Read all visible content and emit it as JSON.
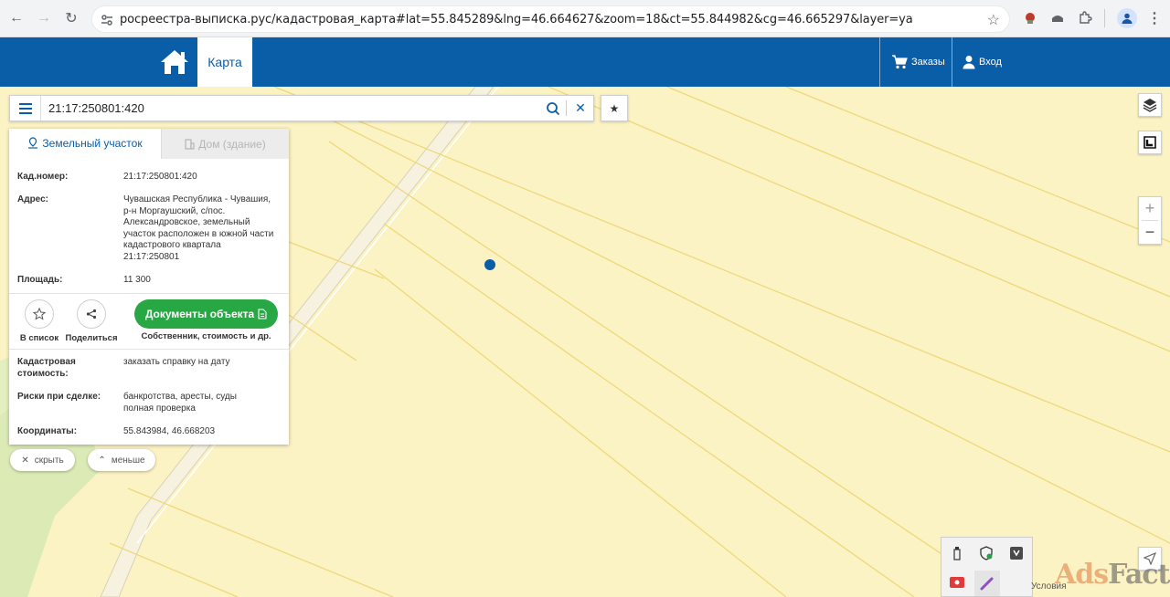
{
  "browser": {
    "url": "росреестра-выписка.рус/кадастровая_карта#lat=55.845289&lng=46.664627&zoom=18&ct=55.844982&cg=46.665297&layer=ya"
  },
  "header": {
    "map_tab": "Карта",
    "orders": "Заказы",
    "login": "Вход"
  },
  "search": {
    "value": "21:17:250801:420"
  },
  "panel": {
    "tab_land": "Земельный участок",
    "tab_house": "Дом (здание)",
    "cadastral_label": "Кад.номер:",
    "cadastral_value": "21:17:250801:420",
    "address_label": "Адрес:",
    "address_value": "Чувашская Республика - Чувашия, р-н Моргаушский, с/пос. Александровское, земельный участок расположен в южной части кадастрового квартала 21:17:250801",
    "area_label": "Площадь:",
    "area_value": "11 300",
    "add_list": "В список",
    "share": "Поделиться",
    "docs_button": "Документы объекта",
    "docs_sub": "Собственник, стоимость и др.",
    "cost_label": "Кадастровая стоимость:",
    "cost_link": "заказать справку на дату",
    "risk_label": "Риски при сделке:",
    "risk_value": "банкротства, аресты, суды",
    "risk_link": "полная проверка",
    "coords_label": "Координаты:",
    "coords_value": "55.843984, 46.668203"
  },
  "controls": {
    "hide": "скрыть",
    "less": "меньше",
    "zoom_in": "+",
    "zoom_out": "−"
  },
  "footer": {
    "attribution": "Условия",
    "watermark_ads": "Ads",
    "watermark_factory": "Factory"
  },
  "colors": {
    "brand": "#0a5ea8",
    "map_bg": "#fcf3c4",
    "parcel_line": "#f0d77a",
    "green_button": "#28a745"
  }
}
